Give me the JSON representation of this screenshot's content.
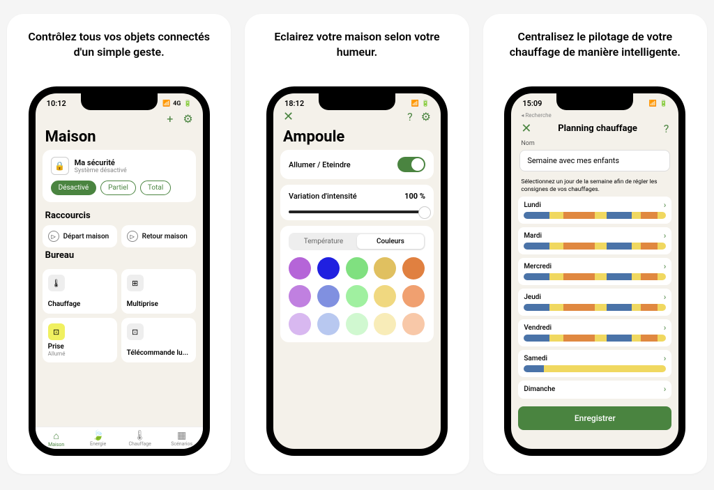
{
  "panel1": {
    "caption": "Contrôlez tous vos objets connectés d'un simple geste.",
    "time": "10:12",
    "signal": "4G",
    "battery": "87",
    "title": "Maison",
    "security": {
      "title": "Ma sécurité",
      "subtitle": "Système désactivé"
    },
    "pills": {
      "off": "Désactivé",
      "partial": "Partiel",
      "total": "Total"
    },
    "shortcuts_h": "Raccourcis",
    "shortcuts": {
      "leave": "Départ maison",
      "return": "Retour maison"
    },
    "room_h": "Bureau",
    "tiles": {
      "heating": "Chauffage",
      "multi": "Multiprise",
      "plug": "Prise",
      "plug_sub": "Allumé",
      "remote": "Télécommande lu..."
    },
    "tabs": {
      "home": "Maison",
      "energy": "Energie",
      "heating": "Chauffage",
      "scenarios": "Scénarios"
    }
  },
  "panel2": {
    "caption": "Eclairez votre maison selon votre humeur.",
    "time": "18:12",
    "title": "Ampoule",
    "onoff": "Allumer / Eteindre",
    "intensity": "Variation d'intensité",
    "intensity_val": "100 %",
    "seg": {
      "temp": "Température",
      "colors": "Couleurs"
    },
    "colors": [
      "#b565d8",
      "#2020e0",
      "#80e080",
      "#e0c060",
      "#e08040",
      "#c080e0",
      "#8090e0",
      "#a0f0a0",
      "#f0d880",
      "#f0a070",
      "#d8b8f0",
      "#b8c8f0",
      "#d0f8d0",
      "#f8ecb8",
      "#f8c8a8"
    ]
  },
  "panel3": {
    "caption": "Centralisez le pilotage de votre chauffage de manière intelligente.",
    "back": "Recherche",
    "time": "15:09",
    "title": "Planning chauffage",
    "input_label": "Nom",
    "input_value": "Semaine avec mes enfants",
    "help": "Sélectionnez un jour de la semaine afin de régler les consignes de vos chauffages.",
    "days": [
      "Lundi",
      "Mardi",
      "Mercredi",
      "Jeudi",
      "Vendredi",
      "Samedi",
      "Dimanche"
    ],
    "save": "Enregistrer",
    "bar_patterns": {
      "weekday": [
        {
          "c": "#4a73a8",
          "w": 18
        },
        {
          "c": "#f0d860",
          "w": 10
        },
        {
          "c": "#e08840",
          "w": 22
        },
        {
          "c": "#f0d860",
          "w": 8
        },
        {
          "c": "#4a73a8",
          "w": 18
        },
        {
          "c": "#f0d860",
          "w": 6
        },
        {
          "c": "#e08840",
          "w": 12
        },
        {
          "c": "#f0d860",
          "w": 6
        }
      ],
      "weekend": [
        {
          "c": "#4a73a8",
          "w": 14
        },
        {
          "c": "#f0d860",
          "w": 86
        }
      ]
    }
  }
}
